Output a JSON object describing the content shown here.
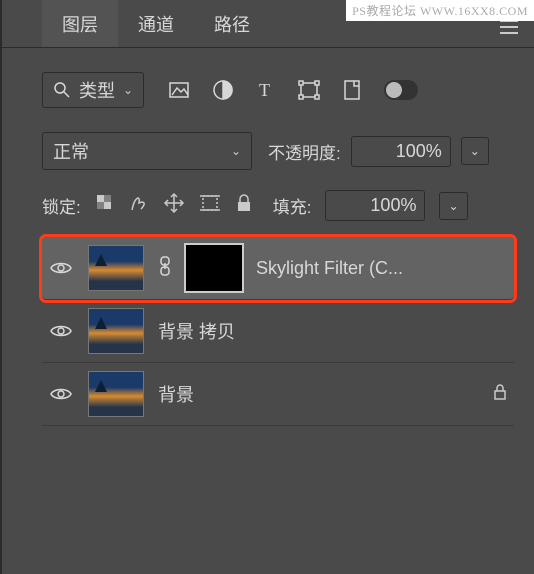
{
  "watermark": "PS教程论坛  WWW.16XX8.COM",
  "tabs": {
    "layers": "图层",
    "channels": "通道",
    "paths": "路径"
  },
  "filter": {
    "type_label": "类型"
  },
  "blend": {
    "mode": "正常",
    "opacity_label": "不透明度:",
    "opacity_value": "100%"
  },
  "lock": {
    "label": "锁定:",
    "fill_label": "填充:",
    "fill_value": "100%"
  },
  "layers_list": [
    {
      "name": "Skylight Filter (C...",
      "selected": true,
      "has_mask": true,
      "locked": false
    },
    {
      "name": "背景 拷贝",
      "selected": false,
      "has_mask": false,
      "locked": false
    },
    {
      "name": "背景",
      "selected": false,
      "has_mask": false,
      "locked": true
    }
  ]
}
